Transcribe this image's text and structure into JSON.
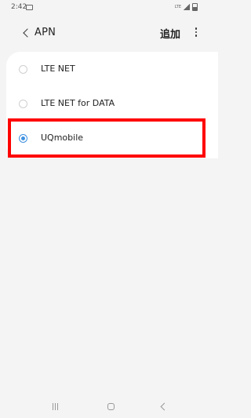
{
  "status_bar": {
    "time": "2:42",
    "signal_text": "LTE"
  },
  "app_bar": {
    "title": "APN",
    "add_label": "追加"
  },
  "apn_list": {
    "items": [
      {
        "label": "LTE NET",
        "selected": false
      },
      {
        "label": "LTE NET for DATA",
        "selected": false
      },
      {
        "label": "UQmobile",
        "selected": true
      }
    ]
  },
  "colors": {
    "accent": "#3e91e0",
    "highlight": "#ff0000",
    "background": "#f4f4f4"
  }
}
